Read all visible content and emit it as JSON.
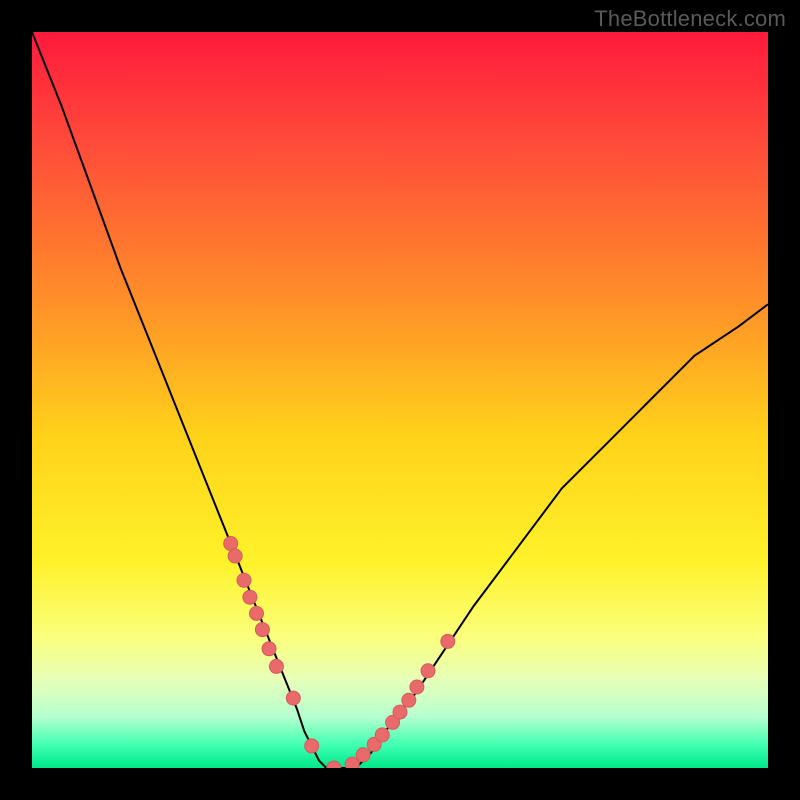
{
  "watermark": "TheBottleneck.com",
  "colors": {
    "curve": "#000000",
    "dots": "#e86a6a",
    "dot_stroke": "#d95a5a"
  },
  "chart_data": {
    "type": "line",
    "title": "",
    "xlabel": "",
    "ylabel": "",
    "xlim": [
      0,
      100
    ],
    "ylim": [
      0,
      100
    ],
    "grid": false,
    "legend": false,
    "series": [
      {
        "name": "bottleneck",
        "x": [
          0,
          4,
          8,
          12,
          16,
          20,
          24,
          28,
          30,
          32,
          34,
          36,
          37,
          38,
          39,
          40,
          42,
          44,
          46,
          48,
          52,
          56,
          60,
          66,
          72,
          78,
          84,
          90,
          96,
          100
        ],
        "values": [
          100,
          90,
          79,
          68,
          58,
          48,
          38,
          28,
          23,
          18,
          13,
          8,
          5,
          3,
          1,
          0,
          0,
          0,
          2,
          5,
          10,
          16,
          22,
          30,
          38,
          44,
          50,
          56,
          60,
          63
        ]
      }
    ],
    "dots": {
      "name": "highlighted-points",
      "x": [
        27.0,
        27.6,
        28.8,
        29.6,
        30.5,
        31.3,
        32.2,
        33.2,
        35.5,
        38.0,
        41.0,
        43.5,
        45.0,
        46.5,
        47.6,
        49.0,
        50.0,
        51.2,
        52.3,
        53.8,
        56.5
      ],
      "values": [
        30.5,
        28.8,
        25.5,
        23.2,
        21.0,
        18.8,
        16.2,
        13.8,
        9.5,
        3.0,
        0.0,
        0.5,
        1.8,
        3.2,
        4.5,
        6.2,
        7.6,
        9.2,
        11.0,
        13.2,
        17.2
      ]
    }
  }
}
